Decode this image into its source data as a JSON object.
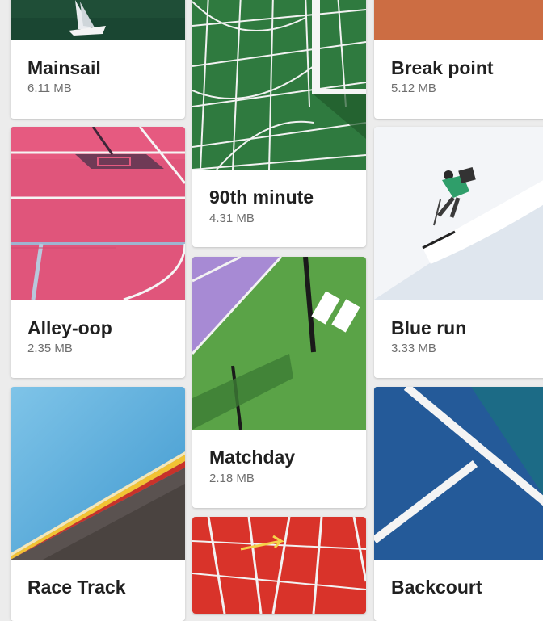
{
  "cards": [
    {
      "title": "Mainsail",
      "size": "6.11 MB",
      "image": "sailboat-on-green-water"
    },
    {
      "title": "90th minute",
      "size": "4.31 MB",
      "image": "soccer-goal-net"
    },
    {
      "title": "Break point",
      "size": "5.12 MB",
      "image": "clay-tennis-court"
    },
    {
      "title": "Alley-oop",
      "size": "2.35 MB",
      "image": "pink-basketball-court"
    },
    {
      "title": "Matchday",
      "size": "2.18 MB",
      "image": "green-tennis-court-net"
    },
    {
      "title": "Blue run",
      "size": "3.33 MB",
      "image": "skier-on-snow-slope"
    },
    {
      "title": "Race Track",
      "size": "",
      "image": "velodrome-track"
    },
    {
      "title": "",
      "size": "",
      "image": "red-running-track"
    },
    {
      "title": "Backcourt",
      "size": "",
      "image": "blue-court-lines"
    }
  ]
}
